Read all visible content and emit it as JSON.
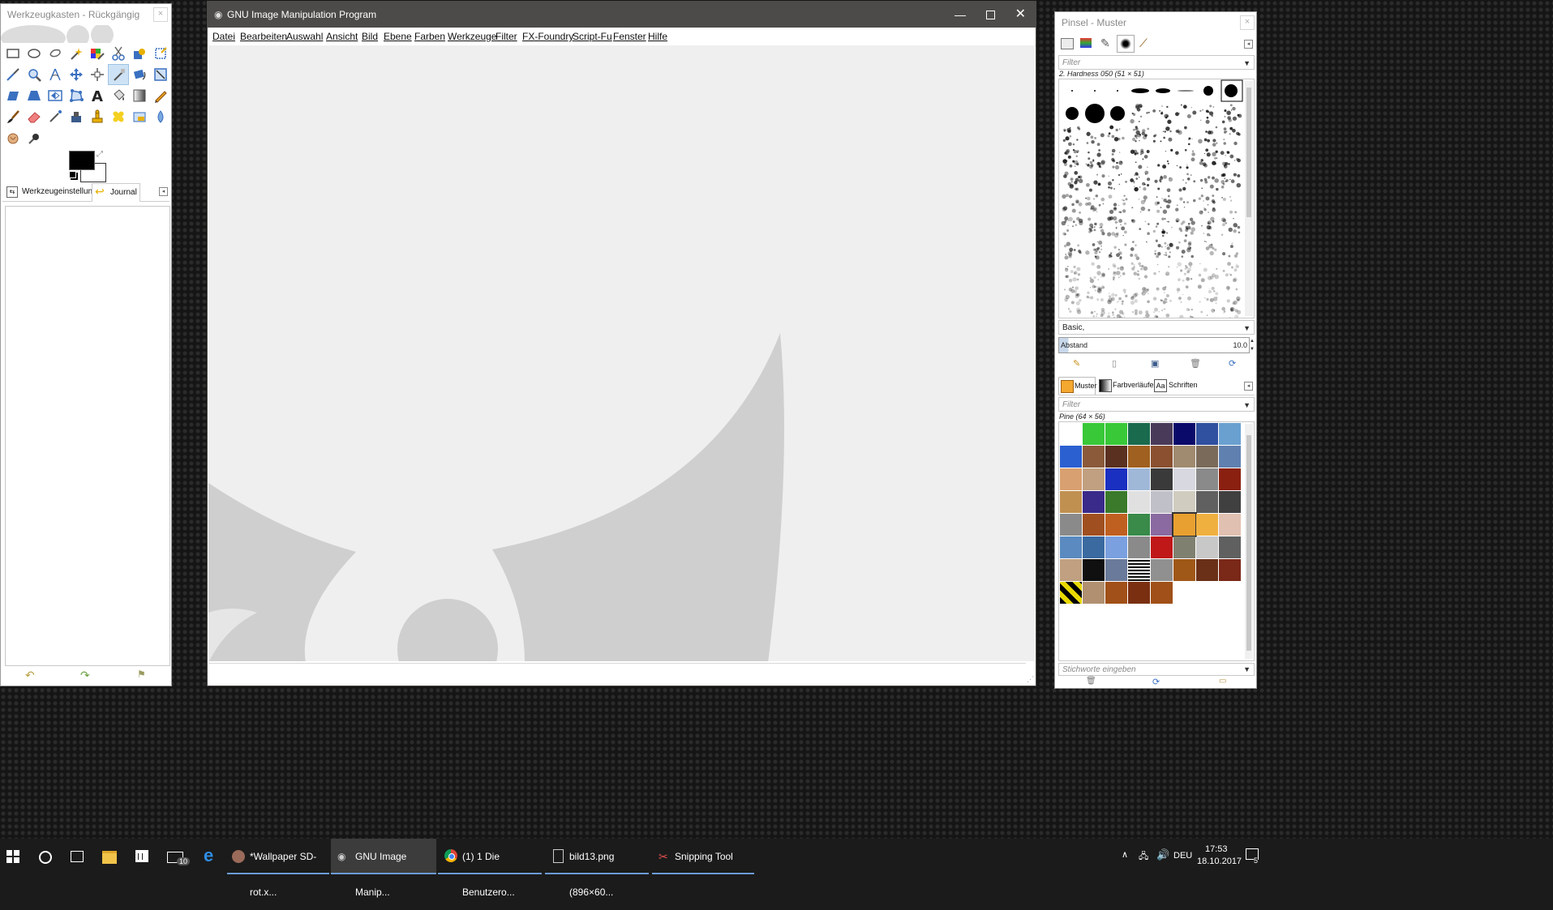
{
  "toolbox": {
    "title": "Werkzeugkasten - Rückgängig",
    "tabs": [
      "Werkzeugeinstellungen",
      "Journal"
    ]
  },
  "gimp": {
    "title": "GNU Image Manipulation Program",
    "menu": [
      "Datei",
      "Bearbeiten",
      "Auswahl",
      "Ansicht",
      "Bild",
      "Ebene",
      "Farben",
      "Werkzeuge",
      "Filter",
      "FX-Foundry",
      "Script-Fu",
      "Fenster",
      "Hilfe"
    ]
  },
  "dock": {
    "title": "Pinsel - Muster",
    "filter_placeholder": "Filter",
    "brush_name": "2. Hardness 050 (51 × 51)",
    "brush_set": "Basic,",
    "spacing_label": "Abstand",
    "spacing_value": "10.0",
    "pattern_tabs": [
      "Muster",
      "Farbverläufe",
      "Schriften"
    ],
    "pattern_name": "Pine (64 × 56)",
    "tags_placeholder": "Stichworte eingeben"
  },
  "taskbar": {
    "mail_badge": "10",
    "apps": [
      "*Wallpaper SD-rot.x...",
      "GNU Image Manip...",
      "(1) 1 Die Benutzero...",
      "bild13.png (896×60...",
      "Snipping Tool"
    ],
    "language": "DEU",
    "time": "17:53",
    "date": "18.10.2017",
    "notification_count": "5"
  },
  "colors": {
    "accent": "#6b9bd6",
    "gimp_titlebar": "#4d4b49",
    "canvas": "#efefef",
    "wilber_shape": "#cfcfcf"
  }
}
